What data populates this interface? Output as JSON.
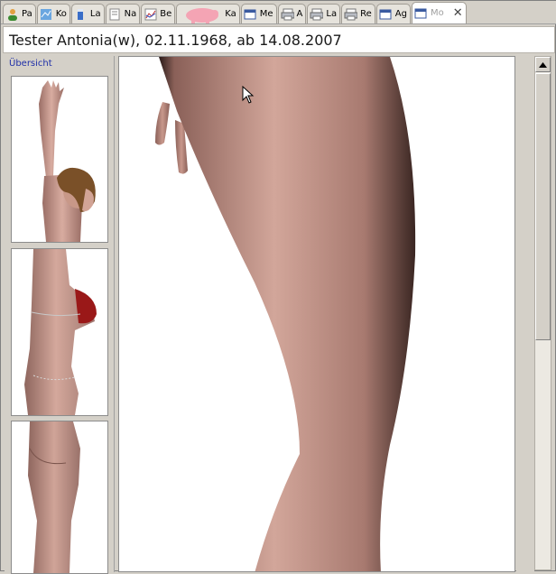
{
  "tabs": [
    {
      "label": "Pa",
      "icon": "person-icon"
    },
    {
      "label": "Ko",
      "icon": "chart-grid-icon"
    },
    {
      "label": "La",
      "icon": "flask-icon"
    },
    {
      "label": "Na",
      "icon": "document-icon"
    },
    {
      "label": "Be",
      "icon": "line-chart-icon"
    },
    {
      "label": "Ka",
      "icon": "piggy-bank-icon"
    },
    {
      "label": "Me",
      "icon": "window-icon"
    },
    {
      "label": "A",
      "icon": "printer-icon"
    },
    {
      "label": "La",
      "icon": "printer-icon"
    },
    {
      "label": "Re",
      "icon": "printer-icon"
    },
    {
      "label": "Ag",
      "icon": "window-icon"
    },
    {
      "label": "Mo",
      "icon": "window-icon",
      "active": true
    }
  ],
  "title": "Tester Antonia(w), 02.11.1968, ab 14.08.2007",
  "sidebar": {
    "overview_link": "Übersicht"
  },
  "colors": {
    "skin": "#c4968c",
    "skin_shadow": "#8a5f58",
    "bikini": "#9a1818",
    "hair": "#7a5028",
    "panel_bg": "#d4d0c8",
    "link": "#1f2fa8"
  }
}
